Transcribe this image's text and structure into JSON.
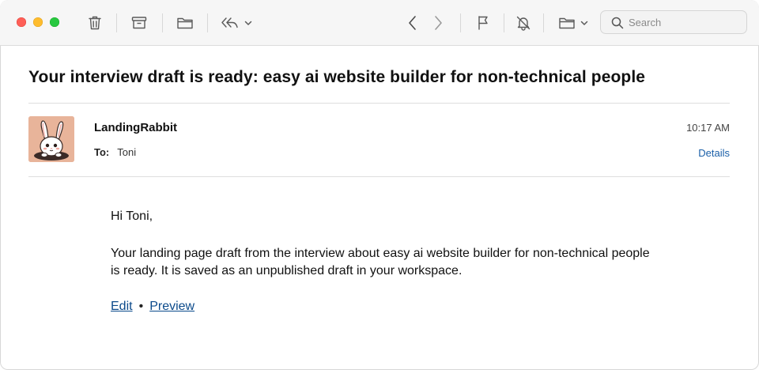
{
  "toolbar": {
    "icons": [
      "trash-icon",
      "archive-icon",
      "folder-icon",
      "reply-icon",
      "chevron-down-icon",
      "chevron-left-icon",
      "chevron-right-icon",
      "flag-icon",
      "mute-bell-icon",
      "move-folder-icon",
      "chevron-down-icon"
    ],
    "search_placeholder": "Search"
  },
  "message": {
    "subject": "Your interview draft is ready: easy ai website builder for non-technical people",
    "sender": "LandingRabbit",
    "to_label": "To:",
    "to_value": "Toni",
    "time": "10:17 AM",
    "details_label": "Details",
    "greeting": "Hi Toni,",
    "paragraph": "Your landing page draft from the interview about easy ai website builder for non-technical people is ready. It is saved as an unpublished draft in your workspace.",
    "edit_label": "Edit",
    "separator": "•",
    "preview_label": "Preview"
  },
  "colors": {
    "toolbar_bg": "#f6f6f6",
    "link": "#0b4a8b",
    "details_link": "#1a5fa8",
    "avatar_bg": "#e8b49a"
  }
}
